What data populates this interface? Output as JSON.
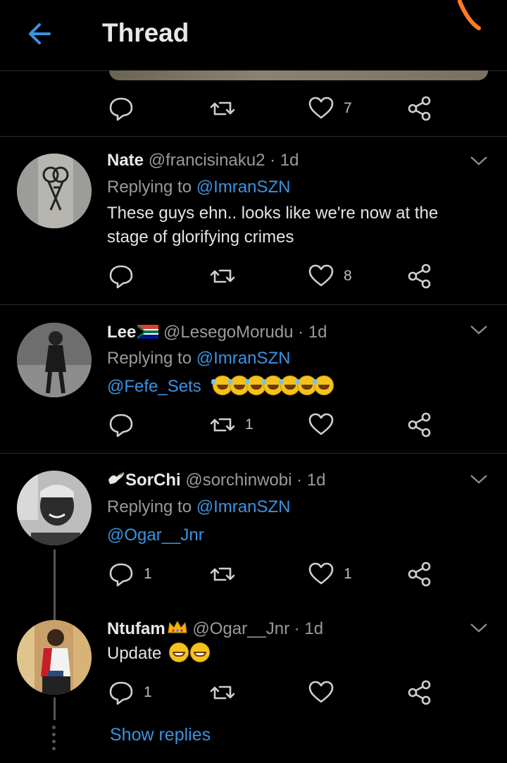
{
  "header": {
    "title": "Thread"
  },
  "colors": {
    "accent": "#3a93e0",
    "background": "#000000",
    "divider": "#2a2a2a"
  },
  "top_actions": {
    "like_count": "7"
  },
  "tweets": [
    {
      "name": "Nate",
      "handle": "@francisinaku2 · 1d",
      "replying_label": "Replying to ",
      "replying_to": "@ImranSZN",
      "text_line1": "These guys ehn.. looks like we're now at the",
      "text_line2": "stage of glorifying crimes",
      "like_count": "8",
      "avatar": "tattoo-photo"
    },
    {
      "name": "Lee",
      "name_emoji": "south-africa-flag",
      "handle": "@LesegoMorudu · 1d",
      "replying_label": "Replying to ",
      "replying_to": "@ImranSZN",
      "mention": "@Fefe_Sets",
      "emoji": "rolling-on-floor-laughing x7",
      "retweet_count": "1",
      "avatar": "person-photo"
    },
    {
      "name": "SorChi",
      "name_emoji": "dove",
      "handle": "@sorchinwobi · 1d",
      "replying_label": "Replying to ",
      "replying_to": "@ImranSZN",
      "mention": "@Ogar__Jnr",
      "reply_count": "1",
      "like_count": "1",
      "avatar": "person-photo"
    },
    {
      "name": "Ntufam",
      "name_emoji": "crown",
      "handle": "@Ogar__Jnr · 1d",
      "text": "Update",
      "emoji": "grinning-face x2",
      "reply_count": "1",
      "avatar": "person-photo"
    }
  ],
  "show_replies": "Show replies",
  "icons": [
    "back-arrow-icon",
    "reply-icon",
    "retweet-icon",
    "like-icon",
    "share-icon",
    "chevron-down-icon"
  ]
}
